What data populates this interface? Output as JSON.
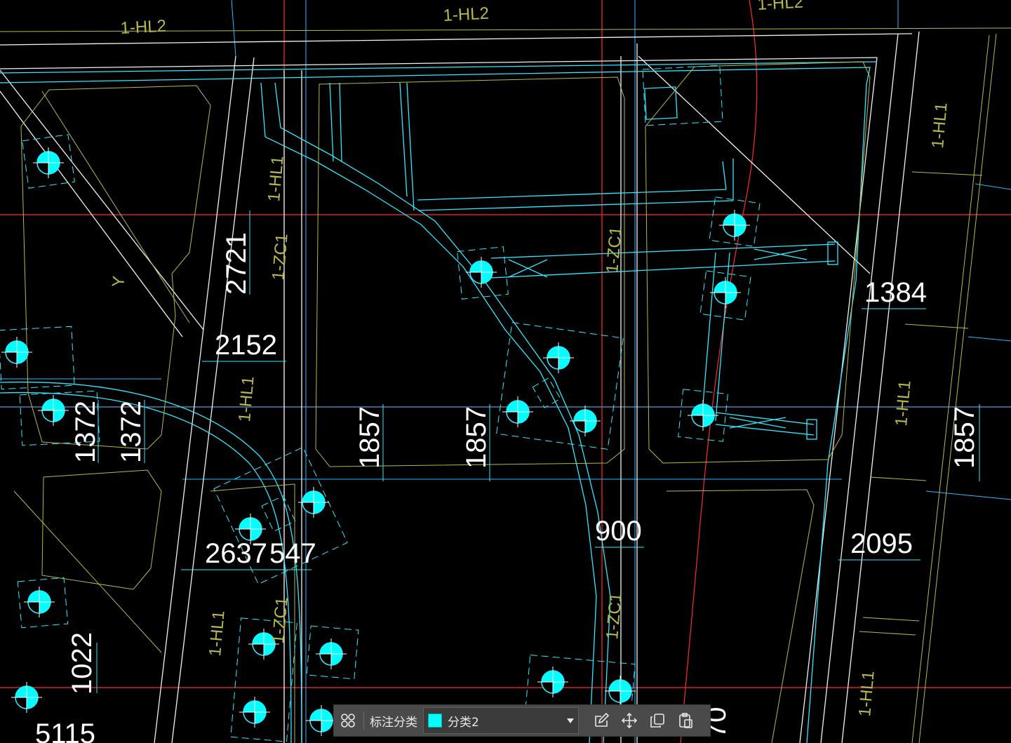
{
  "colors": {
    "background": "#000000",
    "grid_red": "#ff2a2a",
    "cyan": "#2fe9ff",
    "white": "#ffffff",
    "olive": "#b8b84a",
    "light_blue": "#33a6ff",
    "category_swatch": "#00ffff"
  },
  "drawing": {
    "beam_labels": [
      "1-HL2",
      "1-HL2",
      "1-HL2",
      "1-HL1",
      "1-HL1",
      "1-HL1",
      "1-HL1",
      "1-HL1",
      "1-HL1"
    ],
    "column_labels": [
      "1-ZC1",
      "1-ZC1",
      "1-ZC1",
      "1-ZC1"
    ],
    "dimensions": [
      "2721",
      "2152",
      "1384",
      "1372",
      "1372",
      "1857",
      "1857",
      "1857",
      "900",
      "2095",
      "2637",
      "547",
      "1022",
      "5115",
      "70"
    ],
    "misc_label": "Y"
  },
  "toolbar": {
    "grid_icon": "grid-icon",
    "label": "标注分类",
    "selected_category": "分类2",
    "edit_icon": "edit-icon",
    "move_icon": "move-icon",
    "copy_icon": "copy-icon",
    "paste_icon": "paste-icon"
  }
}
